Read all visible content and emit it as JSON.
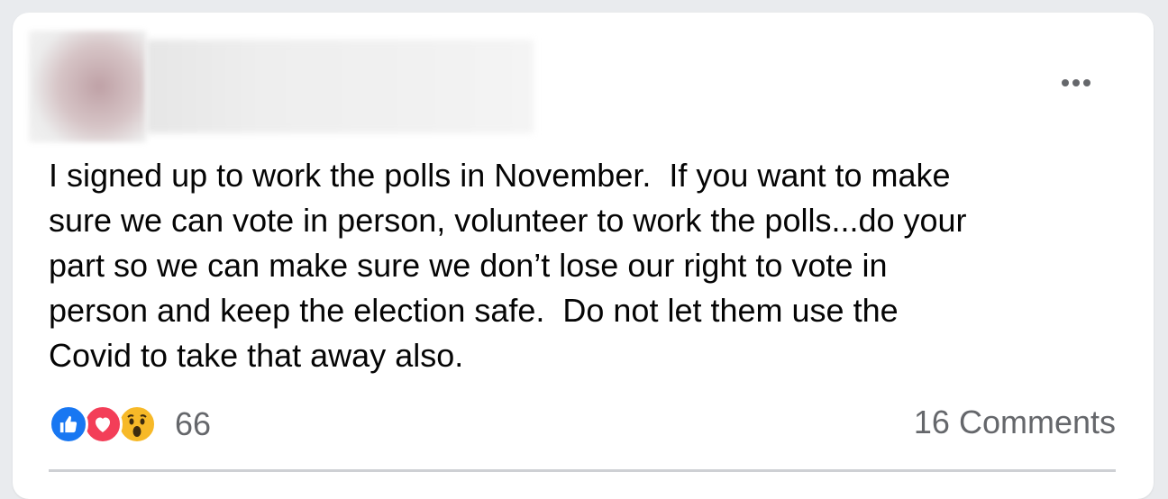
{
  "post": {
    "text": "I signed up to work the polls in November.  If you want to make\nsure we can vote in person, volunteer to work the polls...do your\npart so we can make sure we don’t lose our right to vote in\nperson and keep the election safe.  Do not let them use the\nCovid to take that away also.",
    "more_icon": "ellipsis-icon"
  },
  "reactions": {
    "icons": [
      "like-icon",
      "love-icon",
      "wow-icon"
    ],
    "count": "66"
  },
  "comments_label": "16 Comments",
  "colors": {
    "like": "#1877f2",
    "love": "#f33e58",
    "wow": "#f7b928",
    "secondary_text": "#65676b"
  }
}
